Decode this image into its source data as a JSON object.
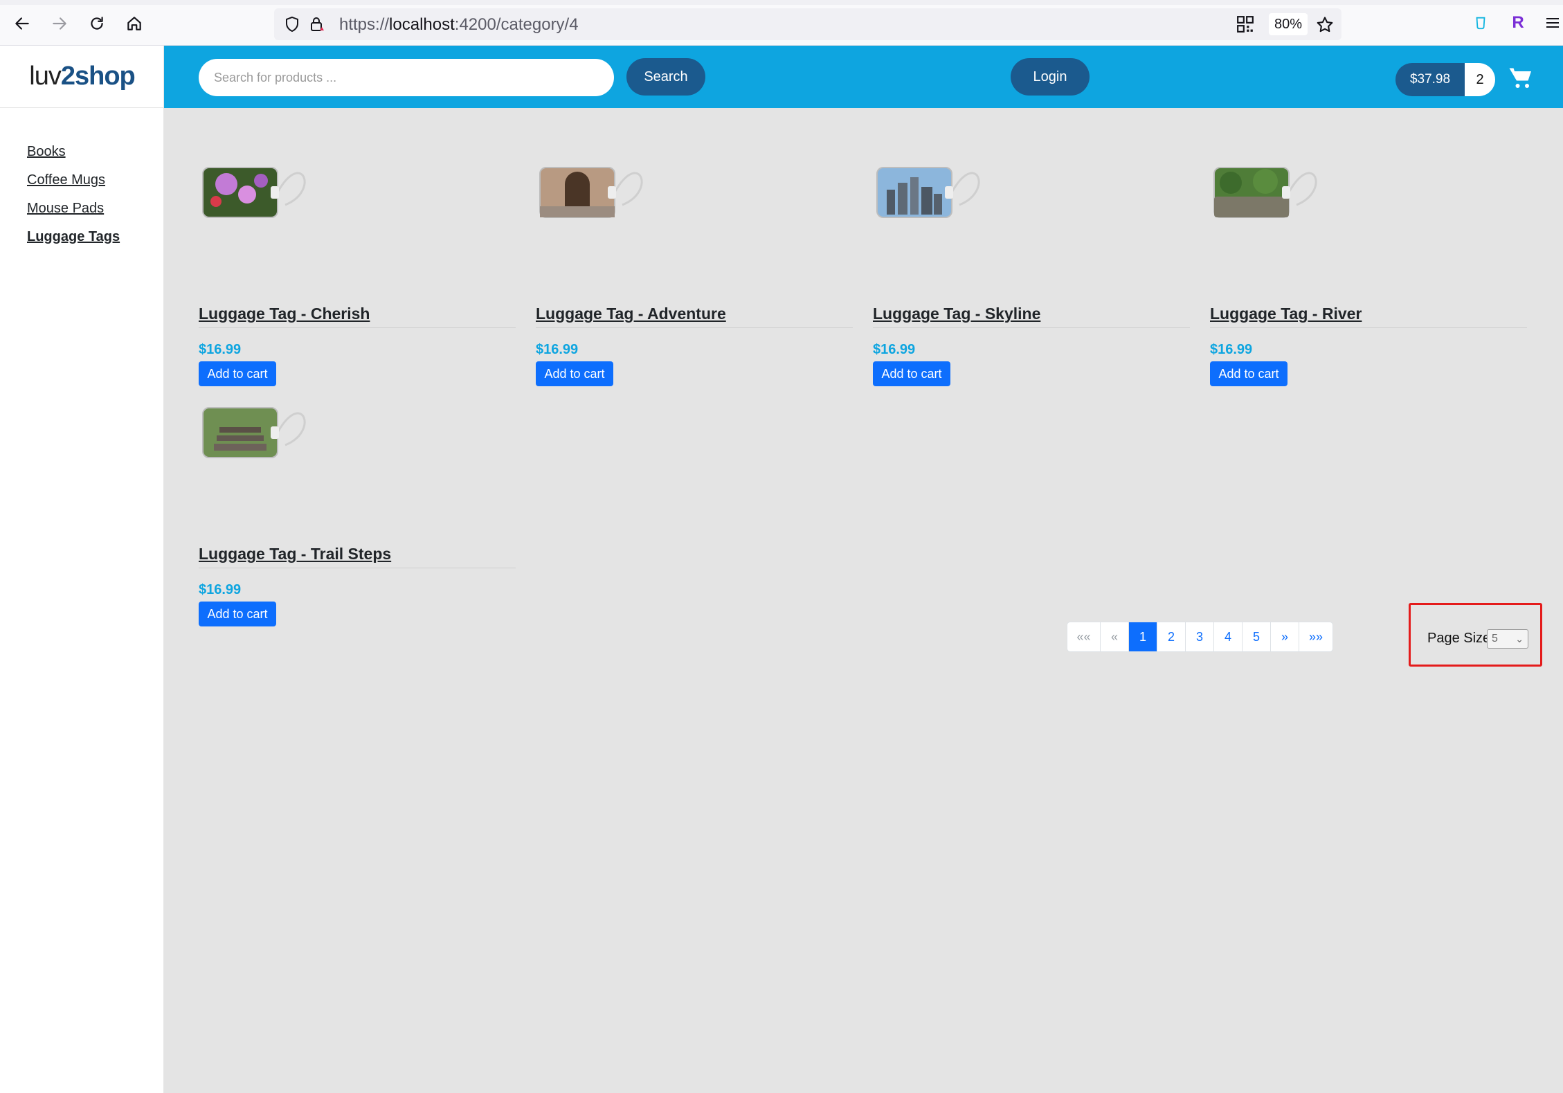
{
  "browser": {
    "url_prefix": "https://",
    "url_host": "localhost",
    "url_rest": ":4200/category/4",
    "zoom": "80%",
    "ext_r_label": "R"
  },
  "app": {
    "logo_part1": "luv",
    "logo_part2": "2",
    "logo_part3": "shop"
  },
  "sidebar": {
    "categories": [
      {
        "label": "Books",
        "active": false
      },
      {
        "label": "Coffee Mugs",
        "active": false
      },
      {
        "label": "Mouse Pads",
        "active": false
      },
      {
        "label": "Luggage Tags",
        "active": true
      }
    ]
  },
  "header": {
    "search_placeholder": "Search for products ...",
    "search_button": "Search",
    "login_button": "Login",
    "cart_total": "$37.98",
    "cart_count": "2"
  },
  "products": [
    {
      "name": "Luggage Tag - Cherish",
      "price": "$16.99",
      "button": "Add to cart",
      "image": "flower-photo"
    },
    {
      "name": "Luggage Tag - Adventure",
      "price": "$16.99",
      "button": "Add to cart",
      "image": "doorway-photo"
    },
    {
      "name": "Luggage Tag - Skyline",
      "price": "$16.99",
      "button": "Add to cart",
      "image": "skyline-photo"
    },
    {
      "name": "Luggage Tag - River",
      "price": "$16.99",
      "button": "Add to cart",
      "image": "river-photo"
    },
    {
      "name": "Luggage Tag - Trail Steps",
      "price": "$16.99",
      "button": "Add to cart",
      "image": "steps-photo"
    }
  ],
  "pagination": {
    "first": "««",
    "prev": "«",
    "pages": [
      "1",
      "2",
      "3",
      "4",
      "5"
    ],
    "current": "1",
    "next": "»",
    "last": "»»"
  },
  "page_size": {
    "label": "Page Size",
    "value": "5"
  },
  "colors": {
    "header_bg": "#0ea5e0",
    "pill_btn": "#1b5a8e",
    "add_btn": "#0d6efd",
    "price": "#0ea5e0",
    "highlight_box": "#e41b1b"
  }
}
